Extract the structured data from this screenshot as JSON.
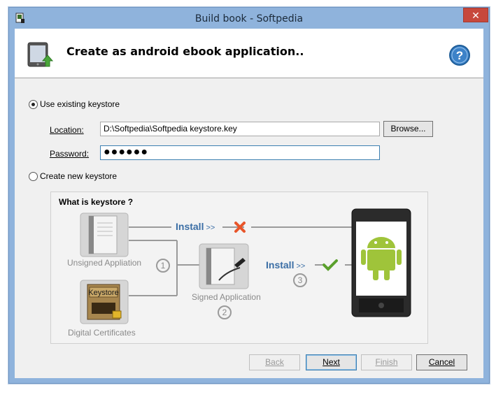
{
  "window": {
    "title": "Build book - Softpedia",
    "close_glyph": "✕"
  },
  "header": {
    "title": "Create as android ebook application..",
    "help_glyph": "?"
  },
  "keystore": {
    "use_existing_label": "Use existing keystore",
    "location_label": "Location:",
    "location_value": "D:\\Softpedia\\Softpedia keystore.key",
    "browse_label": "Browse...",
    "password_label": "Password:",
    "password_value": "●●●●●●",
    "create_new_label": "Create new keystore"
  },
  "diagram": {
    "title": "What is keystore",
    "title_mark": "?",
    "unsigned_label": "Unsigned Appliation",
    "certs_label": "Digital Certificates",
    "certs_box_text": "Keystore",
    "signed_label": "Signed Application",
    "install_label": "Install",
    "arrows_glyph": ">>",
    "steps": [
      "1",
      "2",
      "3"
    ],
    "colors": {
      "install": "#3b6ea5",
      "cross": "#e8552a",
      "check": "#5aa02c",
      "android": "#9fc43a"
    }
  },
  "footer": {
    "back_label": "Back",
    "next_label": "Next",
    "finish_label": "Finish",
    "cancel_label": "Cancel"
  }
}
